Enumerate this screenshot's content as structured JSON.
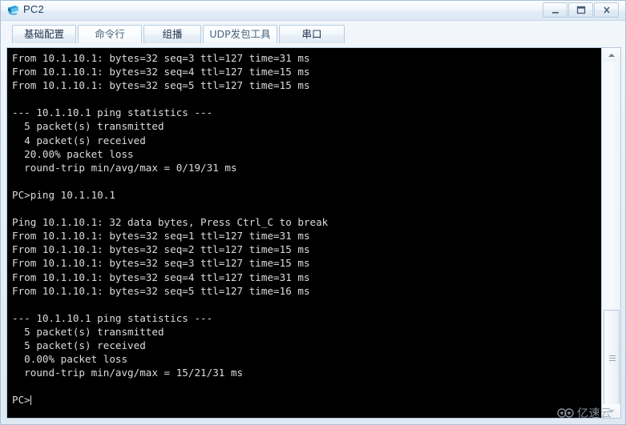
{
  "window": {
    "title": "PC2",
    "icon": "pc-terminal-icon",
    "controls": {
      "minimize": "–",
      "maximize": "❐",
      "close": "X"
    }
  },
  "tabs": [
    {
      "label": "基础配置",
      "selected": false
    },
    {
      "label": "命令行",
      "selected": true
    },
    {
      "label": "组播",
      "selected": false
    },
    {
      "label": "UDP发包工具",
      "selected": true
    },
    {
      "label": "串口",
      "selected": false
    }
  ],
  "console": {
    "text": "From 10.1.10.1: bytes=32 seq=3 ttl=127 time=31 ms\nFrom 10.1.10.1: bytes=32 seq=4 ttl=127 time=15 ms\nFrom 10.1.10.1: bytes=32 seq=5 ttl=127 time=15 ms\n\n--- 10.1.10.1 ping statistics ---\n  5 packet(s) transmitted\n  4 packet(s) received\n  20.00% packet loss\n  round-trip min/avg/max = 0/19/31 ms\n\nPC>ping 10.1.10.1\n\nPing 10.1.10.1: 32 data bytes, Press Ctrl_C to break\nFrom 10.1.10.1: bytes=32 seq=1 ttl=127 time=31 ms\nFrom 10.1.10.1: bytes=32 seq=2 ttl=127 time=15 ms\nFrom 10.1.10.1: bytes=32 seq=3 ttl=127 time=15 ms\nFrom 10.1.10.1: bytes=32 seq=4 ttl=127 time=31 ms\nFrom 10.1.10.1: bytes=32 seq=5 ttl=127 time=16 ms\n\n--- 10.1.10.1 ping statistics ---\n  5 packet(s) transmitted\n  5 packet(s) received\n  0.00% packet loss\n  round-trip min/avg/max = 15/21/31 ms\n\n",
    "prompt": "PC>",
    "foreground": "#dcdcdc",
    "background": "#000000"
  },
  "scrollbar": {
    "up_arrow": "scroll-up-arrow",
    "down_arrow": "scroll-down-arrow"
  },
  "watermark": {
    "text": "亿速云"
  }
}
